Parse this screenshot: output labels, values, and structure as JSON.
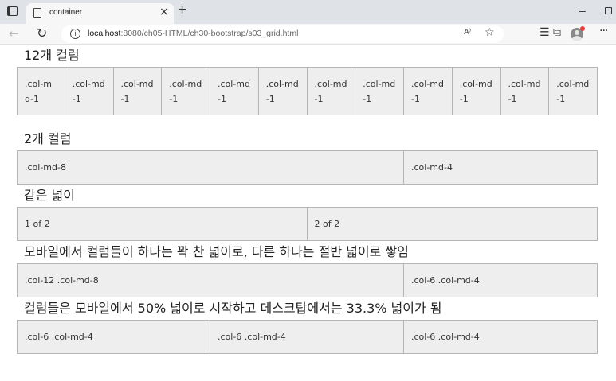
{
  "browser": {
    "tab_title": "container",
    "tab_close_glyph": "×",
    "new_tab_glyph": "+",
    "minimize_glyph": "–",
    "url_host": "localhost",
    "url_rest": ":8080/ch05-HTML/ch30-bootstrap/s03_grid.html",
    "read_aloud_label": "A⁾",
    "icons": {
      "back": "back-arrow-icon",
      "reload": "reload-icon",
      "info": "info-icon",
      "favorites_add": "add-favorite-icon",
      "favorites": "favorites-icon",
      "collections": "collections-icon",
      "profile": "profile-avatar",
      "more": "more-icon"
    }
  },
  "sections": [
    {
      "heading": "12개 컬럼",
      "columns": [
        ".col-md-1",
        ".col-md-1",
        ".col-md-1",
        ".col-md-1",
        ".col-md-1",
        ".col-md-1",
        ".col-md-1",
        ".col-md-1",
        ".col-md-1",
        ".col-md-1",
        ".col-md-1",
        ".col-md-1"
      ]
    },
    {
      "heading": "2개 컬럼",
      "columns": [
        ".col-md-8",
        ".col-md-4"
      ]
    },
    {
      "heading": "같은 넓이",
      "columns": [
        "1 of 2",
        "2 of 2"
      ]
    },
    {
      "heading": "모바일에서 컬럼들이 하나는 꽉 찬 넓이로, 다른 하나는 절반 넓이로 쌓임",
      "columns": [
        ".col-12 .col-md-8",
        ".col-6 .col-md-4"
      ]
    },
    {
      "heading": "컬럼들은 모바일에서 50% 넓이로 시작하고 데스크탑에서는 33.3% 넓이가 됨",
      "columns": [
        ".col-6 .col-md-4",
        ".col-6 .col-md-4",
        ".col-6 .col-md-4"
      ]
    }
  ]
}
